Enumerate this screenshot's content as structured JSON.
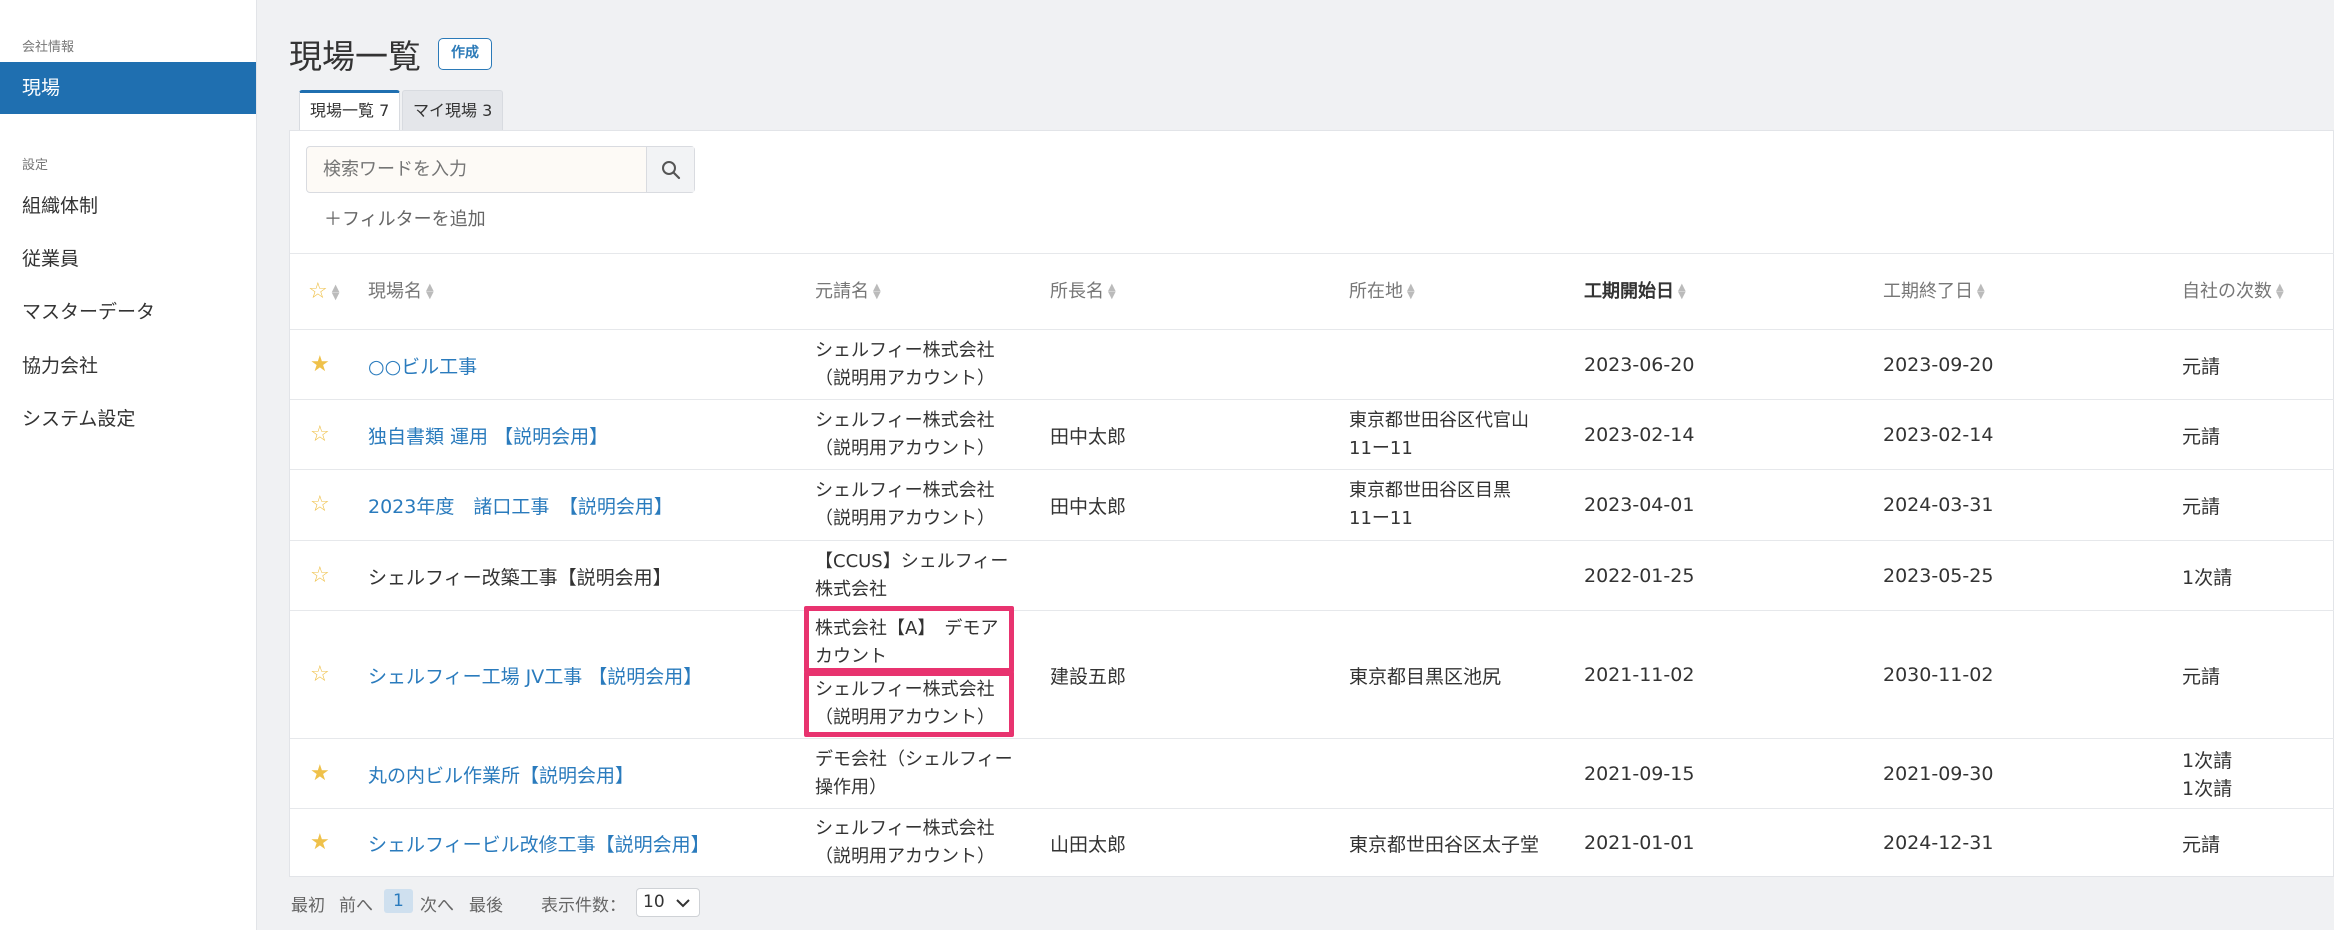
{
  "sidebar": {
    "section_company": "会社情報",
    "item_sites": "現場",
    "section_settings": "設定",
    "items": [
      "組織体制",
      "従業員",
      "マスターデータ",
      "協力会社",
      "システム設定"
    ]
  },
  "header": {
    "title": "現場一覧",
    "create_label": "作成"
  },
  "tabs": [
    {
      "label": "現場一覧 7"
    },
    {
      "label": "マイ現場 3"
    }
  ],
  "search": {
    "placeholder": "検索ワードを入力",
    "filter_add_label": "＋フィルターを追加"
  },
  "table": {
    "headers": [
      "現場名",
      "元請名",
      "所長名",
      "所在地",
      "工期開始日",
      "工期終了日",
      "自社の次数"
    ],
    "rows": [
      {
        "starred": true,
        "name": "○○ビル工事",
        "name_link": true,
        "contractor": "シェルフィー株式会社（説明用アカウント）",
        "manager": "",
        "location": "",
        "start": "2023-06-20",
        "end": "2023-09-20",
        "tier": "元請"
      },
      {
        "starred": false,
        "name": "独自書類 運用 【説明会用】",
        "name_link": true,
        "contractor": "シェルフィー株式会社（説明用アカウント）",
        "manager": "田中太郎",
        "location": "東京都世田谷区代官山11ー11",
        "start": "2023-02-14",
        "end": "2023-02-14",
        "tier": "元請"
      },
      {
        "starred": false,
        "name": "2023年度　諸口工事　【説明会用】",
        "name_link": true,
        "contractor": "シェルフィー株式会社（説明用アカウント）",
        "manager": "田中太郎",
        "location": "東京都世田谷区目黒11ー11",
        "start": "2023-04-01",
        "end": "2024-03-31",
        "tier": "元請"
      },
      {
        "starred": false,
        "name": "シェルフィー改築工事【説明会用】",
        "name_link": false,
        "contractor": "【CCUS】シェルフィー株式会社",
        "manager": "",
        "location": "",
        "start": "2022-01-25",
        "end": "2023-05-25",
        "tier": "1次請"
      },
      {
        "starred": false,
        "name": "シェルフィー工場 JV工事 【説明会用】",
        "name_link": true,
        "contractor": "株式会社【A】　デモアカウント",
        "contractor2": "シェルフィー株式会社（説明用アカウント）",
        "manager": "建設五郎",
        "location": "東京都目黒区池尻",
        "start": "2021-11-02",
        "end": "2030-11-02",
        "tier": "元請"
      },
      {
        "starred": true,
        "name": "丸の内ビル作業所【説明会用】",
        "name_link": true,
        "contractor": "デモ会社（シェルフィー操作用）",
        "manager": "",
        "location": "",
        "start": "2021-09-15",
        "end": "2021-09-30",
        "tier": "1次請",
        "tier2": "1次請"
      },
      {
        "starred": true,
        "name": "シェルフィービル改修工事【説明会用】",
        "name_link": true,
        "contractor": "シェルフィー株式会社（説明用アカウント）",
        "manager": "山田太郎",
        "location": "東京都世田谷区太子堂",
        "start": "2021-01-01",
        "end": "2024-12-31",
        "tier": "元請"
      }
    ]
  },
  "pagination": {
    "first": "最初",
    "prev": "前へ",
    "current": "1",
    "next": "次へ",
    "last": "最後",
    "per_page_label": "表示件数：",
    "per_page_value": "10"
  },
  "colors": {
    "accent": "#1f6fb0",
    "link": "#2a7bbd",
    "star": "#efc14a",
    "highlight": "#e8336f"
  }
}
